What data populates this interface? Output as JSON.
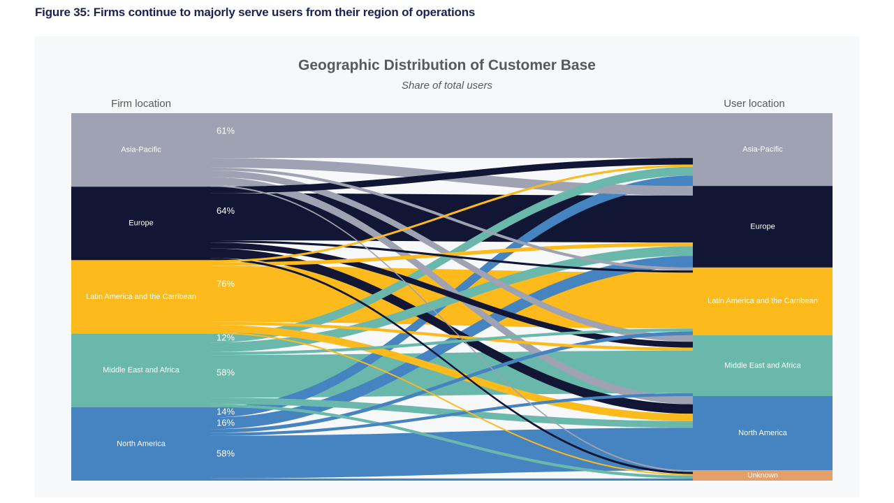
{
  "figure": {
    "caption": "Figure 35: Firms continue to majorly serve users from their region of operations"
  },
  "chart": {
    "title": "Geographic Distribution of Customer Base",
    "subtitle": "Share of total users",
    "left_header": "Firm location",
    "right_header": "User location"
  },
  "colors": {
    "asia_pacific": "#9fa2b2",
    "europe": "#101634",
    "latin_america": "#fcba1d",
    "middle_east_africa": "#69b8ab",
    "north_america": "#4683c1",
    "unknown": "#e3a06a",
    "panel_bg": "#f7f8fa",
    "title_text": "#595959",
    "caption_text": "#1b2252"
  },
  "chart_data": {
    "type": "sankey",
    "title": "Geographic Distribution of Customer Base",
    "subtitle": "Share of total users",
    "units": "percent of total users",
    "source_axis_label": "Firm location",
    "target_axis_label": "User location",
    "sources": [
      {
        "id": "AP",
        "label": "Asia-Pacific",
        "color": "#9fa2b2",
        "value": 100
      },
      {
        "id": "EU",
        "label": "Europe",
        "color": "#101634",
        "value": 100
      },
      {
        "id": "LAC",
        "label": "Latin America and the Carribean",
        "color": "#fcba1d",
        "value": 100
      },
      {
        "id": "MEA",
        "label": "Middle East and Africa",
        "color": "#69b8ab",
        "value": 100
      },
      {
        "id": "NA",
        "label": "North America",
        "color": "#4683c1",
        "value": 100
      }
    ],
    "targets": [
      {
        "id": "AP",
        "label": "Asia-Pacific",
        "color": "#9fa2b2"
      },
      {
        "id": "EU",
        "label": "Europe",
        "color": "#101634"
      },
      {
        "id": "LAC",
        "label": "Latin America and the Carribean",
        "color": "#fcba1d"
      },
      {
        "id": "MEA",
        "label": "Middle East and Africa",
        "color": "#69b8ab"
      },
      {
        "id": "NA",
        "label": "North America",
        "color": "#4683c1"
      },
      {
        "id": "UNK",
        "label": "Unknown",
        "color": "#e3a06a"
      }
    ],
    "links": [
      {
        "source": "AP",
        "target": "AP",
        "value": 61,
        "label": "61%",
        "show_label": true
      },
      {
        "source": "AP",
        "target": "EU",
        "value": 13,
        "label": "13%",
        "show_label": false
      },
      {
        "source": "AP",
        "target": "LAC",
        "value": 4,
        "label": "4%",
        "show_label": false
      },
      {
        "source": "AP",
        "target": "MEA",
        "value": 9,
        "label": "9%",
        "show_label": false
      },
      {
        "source": "AP",
        "target": "NA",
        "value": 11,
        "label": "11%",
        "show_label": false
      },
      {
        "source": "AP",
        "target": "UNK",
        "value": 2,
        "label": "2%",
        "show_label": false
      },
      {
        "source": "EU",
        "target": "AP",
        "value": 9,
        "label": "9%",
        "show_label": false
      },
      {
        "source": "EU",
        "target": "EU",
        "value": 64,
        "label": "64%",
        "show_label": true
      },
      {
        "source": "EU",
        "target": "LAC",
        "value": 3,
        "label": "3%",
        "show_label": false
      },
      {
        "source": "EU",
        "target": "MEA",
        "value": 8,
        "label": "8%",
        "show_label": false
      },
      {
        "source": "EU",
        "target": "NA",
        "value": 13,
        "label": "13%",
        "show_label": false
      },
      {
        "source": "EU",
        "target": "UNK",
        "value": 3,
        "label": "3%",
        "show_label": false
      },
      {
        "source": "LAC",
        "target": "AP",
        "value": 3,
        "label": "3%",
        "show_label": false
      },
      {
        "source": "LAC",
        "target": "EU",
        "value": 5,
        "label": "5%",
        "show_label": false
      },
      {
        "source": "LAC",
        "target": "LAC",
        "value": 76,
        "label": "76%",
        "show_label": true
      },
      {
        "source": "LAC",
        "target": "MEA",
        "value": 4,
        "label": "4%",
        "show_label": false
      },
      {
        "source": "LAC",
        "target": "NA",
        "value": 10,
        "label": "10%",
        "show_label": false
      },
      {
        "source": "LAC",
        "target": "UNK",
        "value": 2,
        "label": "2%",
        "show_label": false
      },
      {
        "source": "MEA",
        "target": "AP",
        "value": 12,
        "label": "12%",
        "show_label": true
      },
      {
        "source": "MEA",
        "target": "EU",
        "value": 13,
        "label": "13%",
        "show_label": false
      },
      {
        "source": "MEA",
        "target": "LAC",
        "value": 4,
        "label": "4%",
        "show_label": false
      },
      {
        "source": "MEA",
        "target": "MEA",
        "value": 58,
        "label": "58%",
        "show_label": true
      },
      {
        "source": "MEA",
        "target": "NA",
        "value": 9,
        "label": "9%",
        "show_label": false
      },
      {
        "source": "MEA",
        "target": "UNK",
        "value": 4,
        "label": "4%",
        "show_label": false
      },
      {
        "source": "NA",
        "target": "AP",
        "value": 14,
        "label": "14%",
        "show_label": true
      },
      {
        "source": "NA",
        "target": "EU",
        "value": 16,
        "label": "16%",
        "show_label": true
      },
      {
        "source": "NA",
        "target": "LAC",
        "value": 5,
        "label": "5%",
        "show_label": false
      },
      {
        "source": "NA",
        "target": "MEA",
        "value": 4,
        "label": "4%",
        "show_label": false
      },
      {
        "source": "NA",
        "target": "NA",
        "value": 58,
        "label": "58%",
        "show_label": true
      },
      {
        "source": "NA",
        "target": "UNK",
        "value": 3,
        "label": "3%",
        "show_label": false
      }
    ],
    "flow_labels_visible": [
      "61%",
      "64%",
      "76%",
      "58%",
      "12%",
      "14%",
      "16%",
      "58%"
    ]
  }
}
